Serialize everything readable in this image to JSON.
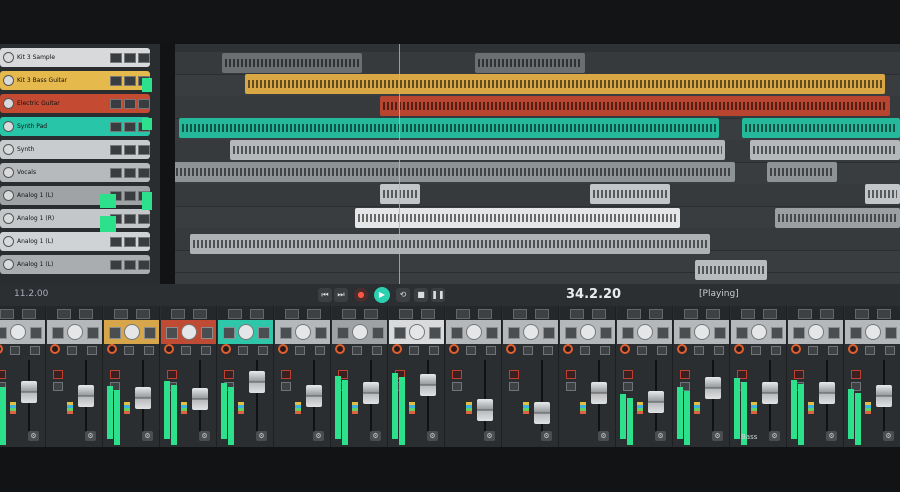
{
  "transport": {
    "time_left": "11.2.00",
    "position": "34.2.20",
    "status": "[Playing]",
    "buttons": [
      "⏮",
      "⏭",
      "●",
      "▶",
      "⟲",
      "■",
      "❚❚"
    ]
  },
  "tracks": [
    {
      "name": "Kit 3 Sample",
      "color": "#d8d9da"
    },
    {
      "name": "Kit 3 Bass Guitar",
      "color": "#e6b94d"
    },
    {
      "name": "Electric Guitar",
      "color": "#c44a32"
    },
    {
      "name": "Synth Pad",
      "color": "#29c5a8"
    },
    {
      "name": "Synth",
      "color": "#c9ccce"
    },
    {
      "name": "Vocals",
      "color": "#b7babd"
    },
    {
      "name": "Analog 1 (L)",
      "color": "#9fa3a6"
    },
    {
      "name": "Analog 1 (R)",
      "color": "#c4c7c9"
    },
    {
      "name": "Analog 1 (L)",
      "color": "#d0d3d5"
    },
    {
      "name": "Analog 1 (L)",
      "color": "#a9adb0"
    }
  ],
  "mixer": {
    "strips": [
      {
        "color": "#b5b8ba",
        "fader": 0.62,
        "meter": 0.78,
        "label": ""
      },
      {
        "color": "#b5b8ba",
        "fader": 0.55,
        "meter": 0.0,
        "label": ""
      },
      {
        "color": "#d7a54a",
        "fader": 0.52,
        "meter": 0.74,
        "label": ""
      },
      {
        "color": "#bf4b35",
        "fader": 0.5,
        "meter": 0.8,
        "label": ""
      },
      {
        "color": "#2ec7a9",
        "fader": 0.8,
        "meter": 0.78,
        "label": ""
      },
      {
        "color": "#b5b8ba",
        "fader": 0.55,
        "meter": 0.0,
        "label": ""
      },
      {
        "color": "#9ea2a5",
        "fader": 0.6,
        "meter": 0.88,
        "label": ""
      },
      {
        "color": "#d8dadb",
        "fader": 0.75,
        "meter": 0.92,
        "label": ""
      },
      {
        "color": "#b5b8ba",
        "fader": 0.3,
        "meter": 0.0,
        "label": ""
      },
      {
        "color": "#b5b8ba",
        "fader": 0.25,
        "meter": 0.0,
        "label": ""
      },
      {
        "color": "#b5b8ba",
        "fader": 0.6,
        "meter": 0.0,
        "label": ""
      },
      {
        "color": "#b5b8ba",
        "fader": 0.45,
        "meter": 0.62,
        "label": ""
      },
      {
        "color": "#b5b8ba",
        "fader": 0.7,
        "meter": 0.72,
        "label": ""
      },
      {
        "color": "#b5b8ba",
        "fader": 0.6,
        "meter": 0.85,
        "label": "Bass"
      },
      {
        "color": "#b5b8ba",
        "fader": 0.6,
        "meter": 0.82,
        "label": ""
      },
      {
        "color": "#b5b8ba",
        "fader": 0.55,
        "meter": 0.7,
        "label": ""
      }
    ]
  }
}
